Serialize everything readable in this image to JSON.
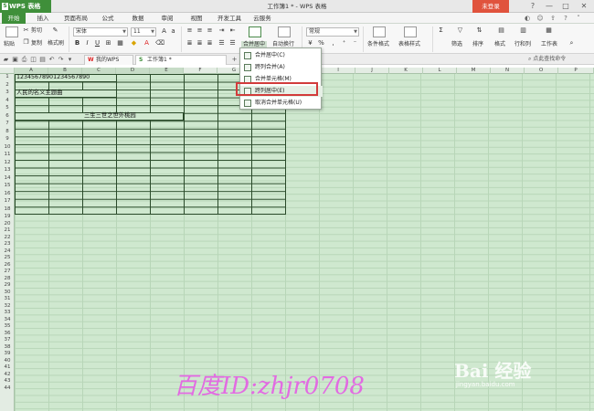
{
  "titlebar": {
    "app_name": "WPS 表格",
    "logo": "S",
    "window_title": "工作簿1 * - WPS 表格",
    "login": "未登录",
    "controls": [
      "?",
      "—",
      "□",
      "✕"
    ]
  },
  "menu": {
    "tabs": [
      "开始",
      "插入",
      "页面布局",
      "公式",
      "数据",
      "审阅",
      "视图",
      "开发工具",
      "云服务"
    ]
  },
  "ribbon": {
    "paste": "粘贴",
    "cut": "剪切",
    "copy": "复制",
    "format_painter": "格式刷",
    "font_name": "宋体",
    "font_size": "11",
    "merge_center": "合并居中",
    "wrap_text": "自动换行",
    "number_format": "常规",
    "conditional_format": "条件格式",
    "table_style": "表格样式",
    "filter": "筛选",
    "sort": "排序",
    "format": "格式",
    "row_col": "行和列",
    "worksheet": "工作表"
  },
  "tabs_bar": {
    "doc_tabs": [
      "我的WPS",
      "工作簿1 *"
    ],
    "search_placeholder": "点此查找命令"
  },
  "columns": [
    "A",
    "B",
    "C",
    "D",
    "E",
    "F",
    "G",
    "H",
    "I",
    "J",
    "K",
    "L",
    "M",
    "N",
    "O",
    "P",
    "Q"
  ],
  "rows": [
    "1",
    "2",
    "3",
    "4",
    "5",
    "6",
    "7",
    "8",
    "9",
    "10",
    "11",
    "12",
    "13",
    "14",
    "15",
    "16",
    "17",
    "18",
    "19",
    "20",
    "21",
    "22",
    "23",
    "24",
    "25",
    "26",
    "27",
    "28",
    "29",
    "30",
    "31",
    "32",
    "33",
    "34",
    "35",
    "36",
    "37",
    "38",
    "39",
    "40",
    "41",
    "42",
    "43",
    "44"
  ],
  "cells": {
    "a1": "12345678901234567890",
    "a3": "人民的名义主题曲",
    "c6": "三生三世之世外桃园"
  },
  "dropdown": {
    "items": [
      "合并居中(C)",
      "跨列合并(A)",
      "合并单元格(M)",
      "跨列居中(E)",
      "取消合并单元格(U)"
    ],
    "highlighted_index": 3
  },
  "watermarks": {
    "baidu_logo": "Bai 经验",
    "baidu_url": "jingyan.baidu.com",
    "author_id": "百度ID:zhjr0708"
  }
}
